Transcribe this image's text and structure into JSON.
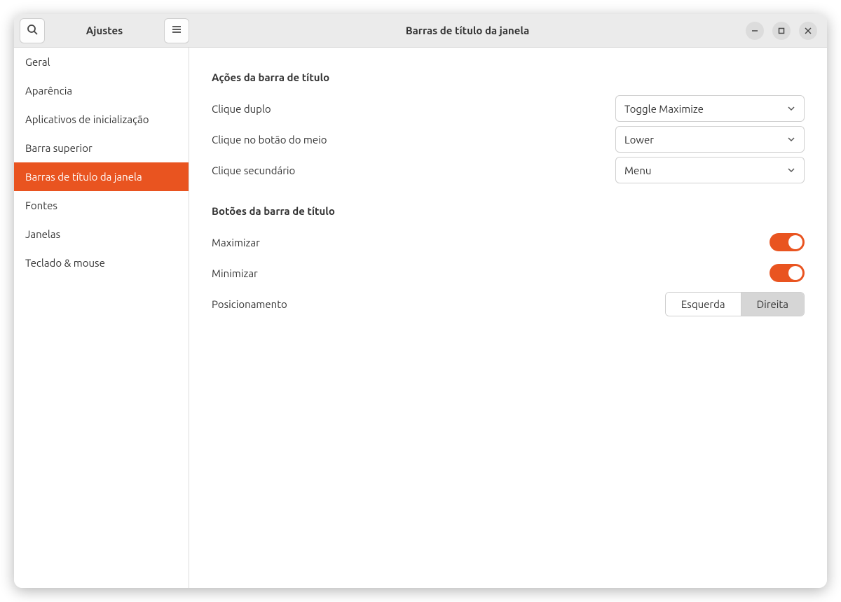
{
  "header": {
    "app_title": "Ajustes",
    "page_title": "Barras de título da janela"
  },
  "sidebar": {
    "items": [
      {
        "label": "Geral",
        "active": false
      },
      {
        "label": "Aparência",
        "active": false
      },
      {
        "label": "Aplicativos de inicialização",
        "active": false
      },
      {
        "label": "Barra superior",
        "active": false
      },
      {
        "label": "Barras de título da janela",
        "active": true
      },
      {
        "label": "Fontes",
        "active": false
      },
      {
        "label": "Janelas",
        "active": false
      },
      {
        "label": "Teclado & mouse",
        "active": false
      }
    ]
  },
  "content": {
    "section1_title": "Ações da barra de título",
    "double_click_label": "Clique duplo",
    "double_click_value": "Toggle Maximize",
    "middle_click_label": "Clique no botão do meio",
    "middle_click_value": "Lower",
    "secondary_click_label": "Clique secundário",
    "secondary_click_value": "Menu",
    "section2_title": "Botões da barra de título",
    "maximize_label": "Maximizar",
    "minimize_label": "Minimizar",
    "placement_label": "Posicionamento",
    "placement_left": "Esquerda",
    "placement_right": "Direita"
  }
}
